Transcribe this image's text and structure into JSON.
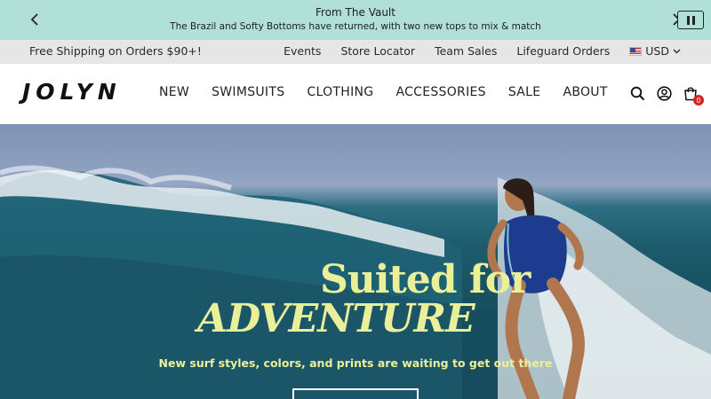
{
  "announcement": {
    "title": "From The Vault",
    "subtitle": "The Brazil and Softy Bottoms have returned, with two new tops to mix & match",
    "prev_icon": "chevron-left-icon",
    "next_icon": "chevron-right-icon",
    "pause_icon": "pause-icon"
  },
  "utility": {
    "shipping": "Free Shipping on Orders $90+!",
    "links": [
      "Events",
      "Store Locator",
      "Team Sales",
      "Lifeguard Orders"
    ],
    "currency": "USD",
    "currency_icon": "us-flag-icon"
  },
  "header": {
    "logo": "JOLYN",
    "nav": [
      "NEW",
      "SWIMSUITS",
      "CLOTHING",
      "ACCESSORIES",
      "SALE",
      "ABOUT"
    ],
    "icons": [
      "search-icon",
      "account-icon",
      "cart-icon"
    ],
    "cart_count": "0"
  },
  "hero": {
    "headline_1": "Suited for",
    "headline_2": "ADVENTURE",
    "tagline": "New surf styles, colors, and prints are waiting to get out there",
    "accent_color": "#eaf09a"
  }
}
